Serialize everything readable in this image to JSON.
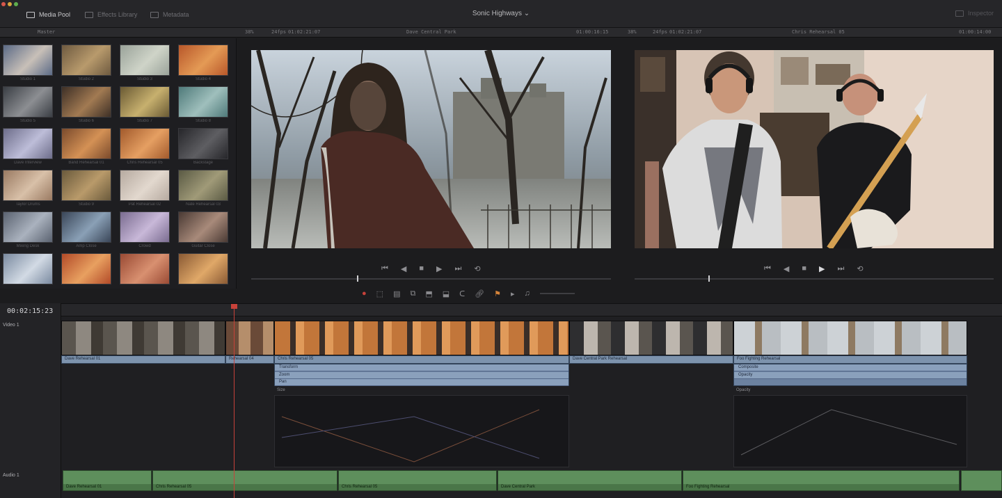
{
  "app": {
    "project_title": "Sonic Highways",
    "tabs": [
      {
        "label": "Media Pool",
        "active": true
      },
      {
        "label": "Effects Library",
        "active": false
      },
      {
        "label": "Metadata",
        "active": false
      }
    ],
    "right_label": "Inspector"
  },
  "viewers": {
    "source": {
      "zoom": "38%",
      "fps": "24fps",
      "timecode_in": "01:02:21:07",
      "clip_name": "Dave Central Park",
      "timecode_out": "01:00:16:15"
    },
    "timeline": {
      "zoom": "38%",
      "fps": "24fps",
      "timecode_in": "01:02:21:07",
      "clip_name": "Chris Rehearsal 05",
      "timecode_out": "01:00:14:00"
    }
  },
  "media_pool": {
    "clips": [
      "Studio 1",
      "Studio 2",
      "Studio 3",
      "Studio 4",
      "Studio 5",
      "Studio 6",
      "Studio 7",
      "Studio 8",
      "Dave Interview",
      "Band Rehearsal 01",
      "Chris Rehearsal 05",
      "Backstage",
      "Taylor Drums",
      "Studio 9",
      "Pat Rehearsal 02",
      "Nate Rehearsal 03",
      "Mixing Desk",
      "Amp Close",
      "Crowd",
      "Guitar Close",
      "Studio 10",
      "Studio 11",
      "Studio 12",
      "Studio 13"
    ]
  },
  "timeline": {
    "timecode": "00:02:15:23",
    "video_track_label": "Video 1",
    "audio_track_label": "Audio 1",
    "clips": [
      {
        "label": "Dave Rehearsal 01"
      },
      {
        "label": "Rehearsal 04"
      },
      {
        "label": "Chris Rehearsal 05"
      },
      {
        "label": "Dave Central Park Rehearsal"
      },
      {
        "label": "Foo Fighting Rehearsal"
      }
    ],
    "fx": [
      {
        "title": "Transform",
        "param1": "Zoom",
        "param2": "Pan",
        "row_label": "Size"
      },
      {
        "title": "Composite",
        "param1": "Opacity",
        "row_label": "Opacity"
      }
    ],
    "audio_clips": [
      "Dave Rehearsal 01",
      "Chris Rehearsal 05",
      "Chris Rehearsal 05",
      "Dave Central Park",
      "Foo Fighting Rehearsal"
    ]
  },
  "colors": {
    "accent_red": "#c8423a",
    "video_clip_bar": "#7d93ad",
    "audio_clip": "#5e8f5c"
  }
}
